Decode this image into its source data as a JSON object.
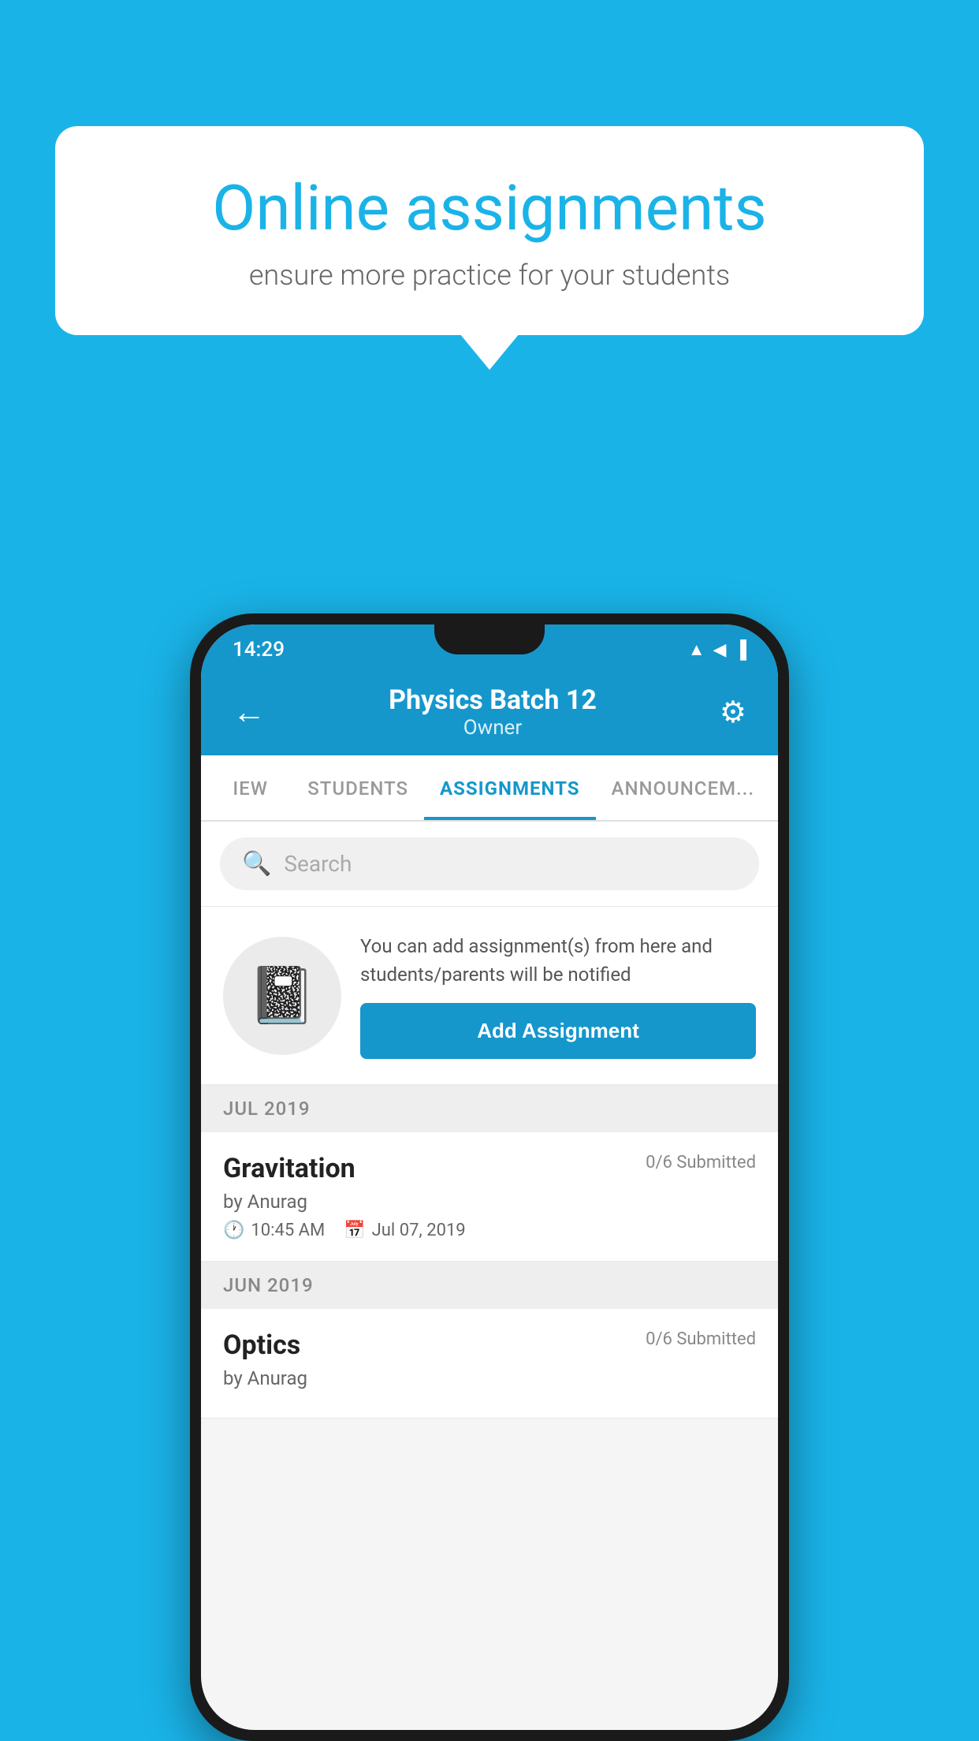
{
  "background_color": "#1ab3e8",
  "promo": {
    "title": "Online assignments",
    "subtitle": "ensure more practice for your students"
  },
  "phone": {
    "status_bar": {
      "time": "14:29",
      "icons": [
        "wifi",
        "signal",
        "battery"
      ]
    },
    "header": {
      "title": "Physics Batch 12",
      "subtitle": "Owner",
      "back_label": "←",
      "gear_label": "⚙"
    },
    "tabs": [
      {
        "label": "IEW",
        "active": false
      },
      {
        "label": "STUDENTS",
        "active": false
      },
      {
        "label": "ASSIGNMENTS",
        "active": true
      },
      {
        "label": "ANNOUNCEM...",
        "active": false
      }
    ],
    "search": {
      "placeholder": "Search"
    },
    "add_assignment_promo": {
      "description": "You can add assignment(s) from here and students/parents will be notified",
      "button_label": "Add Assignment"
    },
    "months": [
      {
        "label": "JUL 2019",
        "assignments": [
          {
            "title": "Gravitation",
            "submitted": "0/6 Submitted",
            "author": "by Anurag",
            "time": "10:45 AM",
            "date": "Jul 07, 2019"
          }
        ]
      },
      {
        "label": "JUN 2019",
        "assignments": [
          {
            "title": "Optics",
            "submitted": "0/6 Submitted",
            "author": "by Anurag",
            "time": "",
            "date": ""
          }
        ]
      }
    ]
  }
}
